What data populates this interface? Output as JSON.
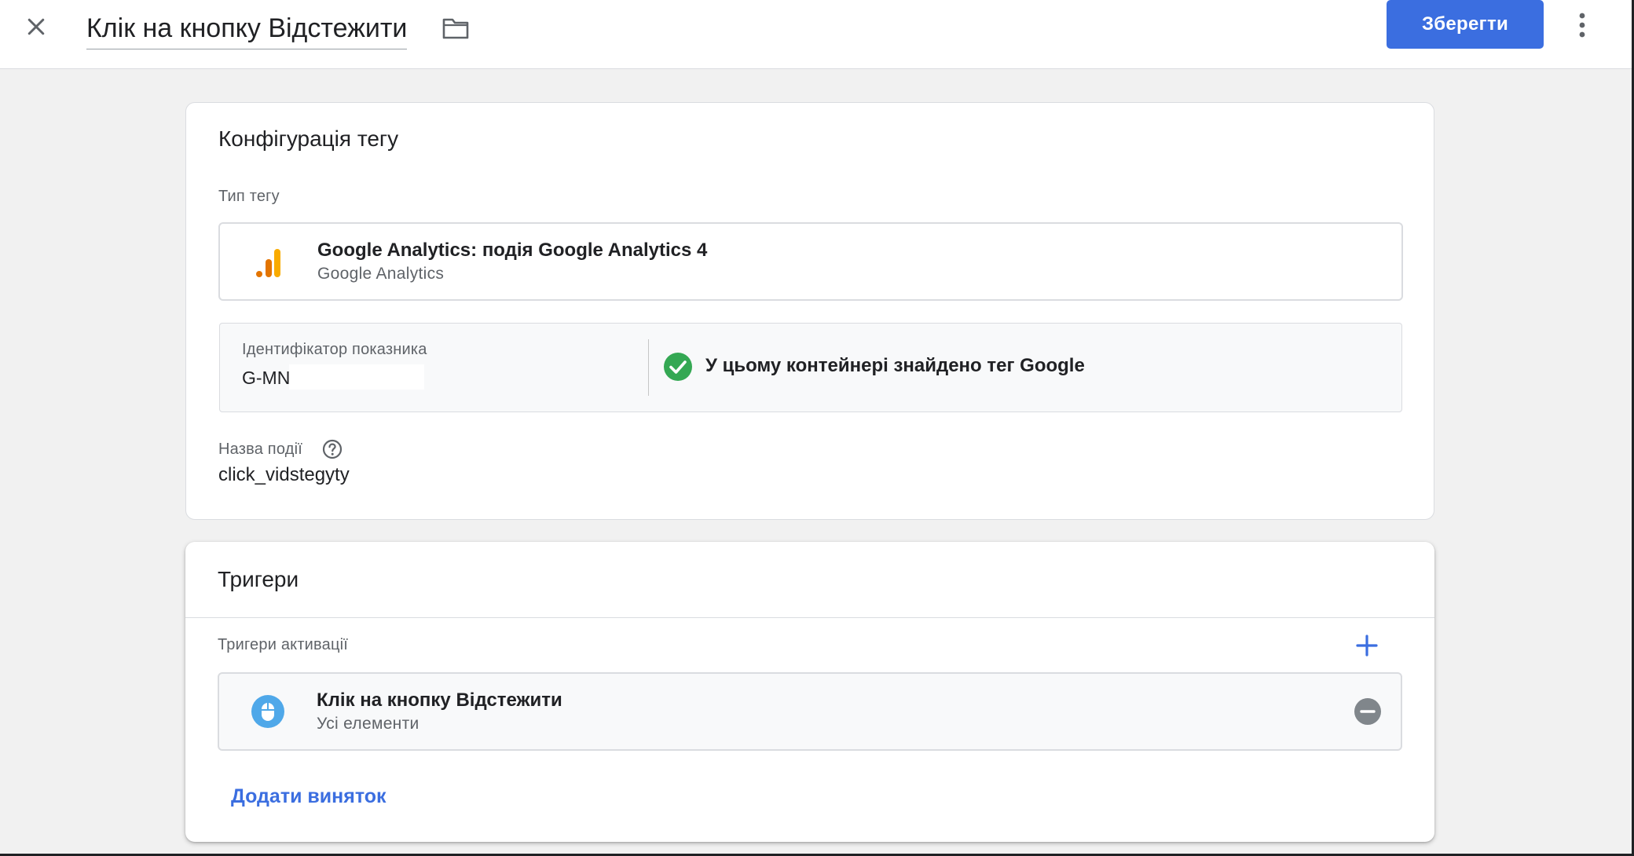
{
  "header": {
    "tag_name": "Клік на кнопку Відстежити",
    "save_label": "Зберегти",
    "icons": {
      "close": "close-icon",
      "folder": "folder-icon",
      "more": "more-vert-icon"
    }
  },
  "config": {
    "title": "Конфігурація тегу",
    "tag_type_label": "Тип тегу",
    "tag_type": {
      "name": "Google Analytics: подія Google Analytics 4",
      "vendor": "Google Analytics",
      "icon": "google-analytics-icon"
    },
    "measurement": {
      "label": "Ідентифікатор показника",
      "value": "G-MN",
      "status": "У цьому контейнері знайдено тег Google",
      "status_icon": "check-circle-icon"
    },
    "event_name": {
      "label": "Назва події",
      "value": "click_vidstegyty",
      "help_icon": "help-circle-icon"
    }
  },
  "triggers": {
    "title": "Тригери",
    "firing_label": "Тригери активації",
    "items": [
      {
        "name": "Клік на кнопку Відстежити",
        "subtitle": "Усі елементи",
        "icon": "mouse-click-icon"
      }
    ],
    "add_exception_label": "Додати виняток"
  },
  "colors": {
    "accent": "#3b6ee0",
    "success": "#34a853",
    "ga_orange": "#e37400",
    "ga_yellow": "#f9ab00",
    "trigger_blue": "#4fa8e9",
    "canvas_bg": "#f1f1f1"
  }
}
